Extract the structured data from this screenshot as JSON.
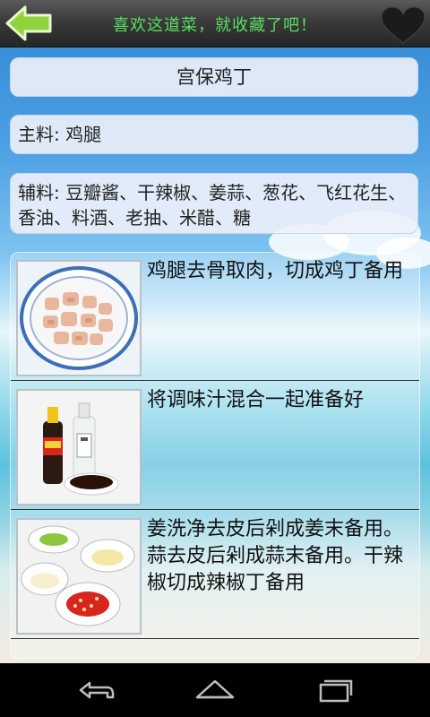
{
  "header": {
    "banner_text": "喜欢这道菜，就收藏了吧！",
    "back_icon": "arrow-left-icon",
    "favorite_icon": "heart-icon",
    "accent_color": "#58e05f"
  },
  "recipe": {
    "title": "宫保鸡丁",
    "main_ingredient": "主料: 鸡腿",
    "aux_ingredients": "辅料: 豆瓣酱、干辣椒、姜蒜、葱花、飞红花生、香油、料酒、老抽、米醋、糖"
  },
  "steps": [
    {
      "text": "鸡腿去骨取肉，切成鸡丁备用",
      "image": "diced-chicken-plate"
    },
    {
      "text": "将调味汁混合一起准备好",
      "image": "sauce-bottles-and-bowl"
    },
    {
      "text": "姜洗净去皮后剁成姜末备用。蒜去皮后剁成蒜末备用。干辣椒切成辣椒丁备用",
      "image": "chopped-aromatics-bowls"
    }
  ],
  "navbar": {
    "back_icon": "nav-back-icon",
    "home_icon": "nav-home-icon",
    "recents_icon": "nav-recents-icon"
  }
}
